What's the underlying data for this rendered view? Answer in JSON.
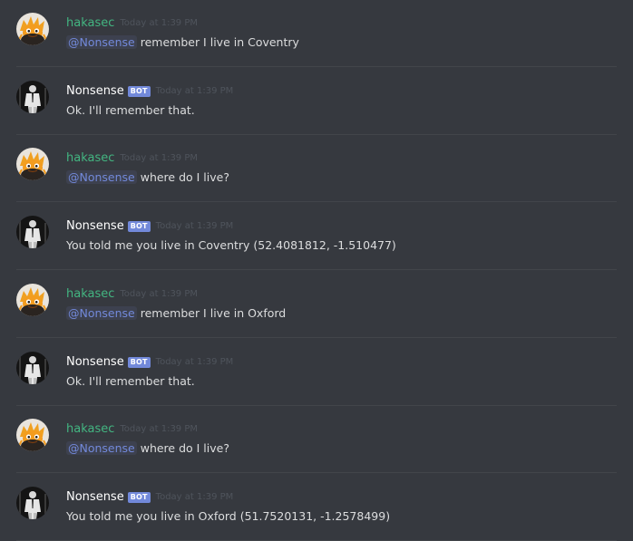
{
  "users": {
    "human": {
      "name": "hakasec"
    },
    "bot": {
      "name": "Nonsense",
      "tag": "BOT"
    }
  },
  "messages": [
    {
      "author": "hakasec",
      "is_bot": false,
      "timestamp": "Today at 1:39 PM",
      "mention": "@Nonsense",
      "text": " remember I live in Coventry"
    },
    {
      "author": "Nonsense",
      "is_bot": true,
      "bot_tag": "BOT",
      "timestamp": "Today at 1:39 PM",
      "mention": "",
      "text": "Ok. I'll remember that."
    },
    {
      "author": "hakasec",
      "is_bot": false,
      "timestamp": "Today at 1:39 PM",
      "mention": "@Nonsense",
      "text": " where do I live?"
    },
    {
      "author": "Nonsense",
      "is_bot": true,
      "bot_tag": "BOT",
      "timestamp": "Today at 1:39 PM",
      "mention": "",
      "text": "You told me you live in Coventry (52.4081812, -1.510477)"
    },
    {
      "author": "hakasec",
      "is_bot": false,
      "timestamp": "Today at 1:39 PM",
      "mention": "@Nonsense",
      "text": " remember I live in Oxford"
    },
    {
      "author": "Nonsense",
      "is_bot": true,
      "bot_tag": "BOT",
      "timestamp": "Today at 1:39 PM",
      "mention": "",
      "text": "Ok. I'll remember that."
    },
    {
      "author": "hakasec",
      "is_bot": false,
      "timestamp": "Today at 1:39 PM",
      "mention": "@Nonsense",
      "text": " where do I live?"
    },
    {
      "author": "Nonsense",
      "is_bot": true,
      "bot_tag": "BOT",
      "timestamp": "Today at 1:39 PM",
      "mention": "",
      "text": "You told me you live in Oxford (51.7520131, -1.2578499)"
    }
  ],
  "colors": {
    "background": "#36393f",
    "user_name": "#43b581",
    "bot_name": "#ffffff",
    "bot_tag_bg": "#7289da",
    "mention_text": "#7289da",
    "mention_bg": "#3d414f",
    "message_text": "#dcddde",
    "timestamp": "#4f545c"
  },
  "icons": {
    "human_avatar": "orange-creature-avatar-icon",
    "bot_avatar": "suited-figure-avatar-icon"
  }
}
